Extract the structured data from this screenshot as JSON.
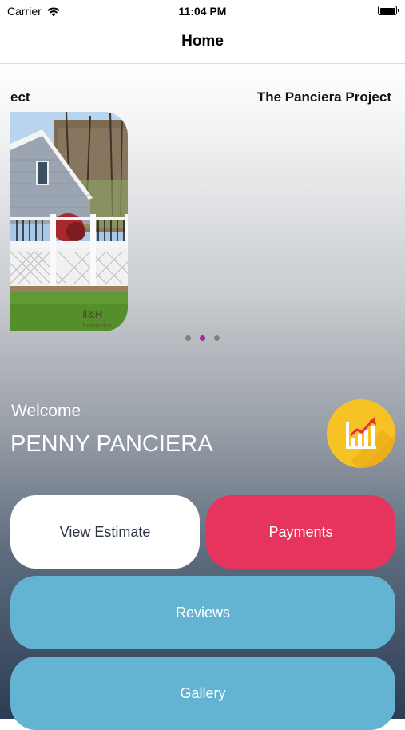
{
  "status_bar": {
    "carrier": "Carrier",
    "time": "11:04 PM",
    "wifi_icon": "wifi-icon",
    "battery_icon": "battery-icon"
  },
  "nav": {
    "title": "Home"
  },
  "carousel": {
    "prev_title_fragment": "ect",
    "current_title": "The Panciera Project",
    "photo_watermark": "Restoration",
    "page_count": 3,
    "active_page": 2,
    "colors": {
      "dot": "#808080",
      "dot_active": "#a02aa0"
    }
  },
  "welcome": {
    "label": "Welcome",
    "name": "PENNY PANCIERA"
  },
  "stats_button": {
    "icon": "chart-growth-icon",
    "color": "#f7c224"
  },
  "actions": {
    "view_estimate": "View Estimate",
    "payments": "Payments",
    "reviews": "Reviews",
    "gallery": "Gallery"
  },
  "colors": {
    "payments": "#e5345d",
    "reviews": "#63b3d3",
    "gallery": "#63b3d3",
    "estimate": "#ffffff"
  }
}
